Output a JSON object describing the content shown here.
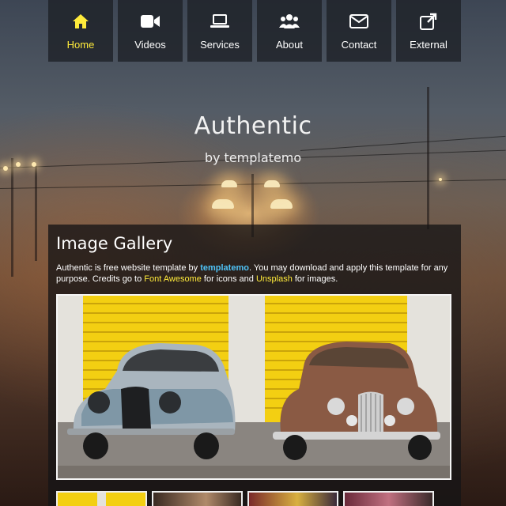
{
  "nav": [
    {
      "label": "Home",
      "icon": "home-icon",
      "active": true
    },
    {
      "label": "Videos",
      "icon": "video-camera-icon",
      "active": false
    },
    {
      "label": "Services",
      "icon": "laptop-icon",
      "active": false
    },
    {
      "label": "About",
      "icon": "users-icon",
      "active": false
    },
    {
      "label": "Contact",
      "icon": "envelope-icon",
      "active": false
    },
    {
      "label": "External",
      "icon": "external-link-icon",
      "active": false
    }
  ],
  "hero": {
    "title": "Authentic",
    "subtitle": "by templatemo"
  },
  "gallery": {
    "title": "Image Gallery",
    "intro_1": "Authentic is free website template by ",
    "brand_link": "templatemo",
    "intro_2": ". You may download and apply this template for any purpose. Credits go to ",
    "fa_link": "Font Awesome",
    "intro_3": " for icons and ",
    "unsplash_link": "Unsplash",
    "intro_4": " for images."
  },
  "colors": {
    "active_nav": "#ffeb3b",
    "link_blue": "#4fc3f7",
    "link_yellow": "#ffeb3b",
    "nav_bg": "#1e2228"
  }
}
